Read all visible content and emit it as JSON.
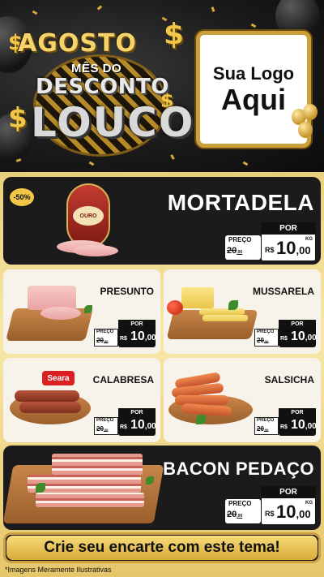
{
  "header": {
    "title_line1": "AGOSTO",
    "title_line2": "MÊS DO",
    "title_line3": "DESCONTO",
    "title_line4": "LOUCO",
    "logo_line1": "Sua Logo",
    "logo_line2": "Aqui"
  },
  "featured": [
    {
      "name": "MORTADELA",
      "badge": "-50%",
      "brand": "OURO",
      "por_label": "POR",
      "preco_label": "PREÇO",
      "old_price": "20",
      "old_cents": ",00",
      "currency": "R$",
      "price": "10",
      "cents": ",00",
      "unit": "KG"
    },
    {
      "name": "BACON PEDAÇO",
      "por_label": "POR",
      "preco_label": "PREÇO",
      "old_price": "20",
      "old_cents": ",00",
      "currency": "R$",
      "price": "10",
      "cents": ",00",
      "unit": "KG"
    }
  ],
  "grid": [
    {
      "name": "PRESUNTO",
      "por_label": "POR",
      "preco_label": "PREÇO",
      "old_price": "20",
      "old_cents": ",00",
      "currency": "R$",
      "price": "10",
      "cents": ",00"
    },
    {
      "name": "MUSSARELA",
      "por_label": "POR",
      "preco_label": "PREÇO",
      "old_price": "20",
      "old_cents": ",00",
      "currency": "R$",
      "price": "10",
      "cents": ",00"
    },
    {
      "name": "CALABRESA",
      "brand": "Seara",
      "por_label": "POR",
      "preco_label": "PREÇO",
      "old_price": "20",
      "old_cents": ",00",
      "currency": "R$",
      "price": "10",
      "cents": ",00"
    },
    {
      "name": "SALSICHA",
      "por_label": "POR",
      "preco_label": "PREÇO",
      "old_price": "20",
      "old_cents": ",00",
      "currency": "R$",
      "price": "10",
      "cents": ",00"
    }
  ],
  "cta": "Crie seu encarte com este tema!",
  "disclaimer": "*Imagens Meramente Ilustrativas",
  "colors": {
    "gold": "#d9aa38",
    "dark_card": "#1b1b1b",
    "light_card": "#f7f3ea"
  }
}
